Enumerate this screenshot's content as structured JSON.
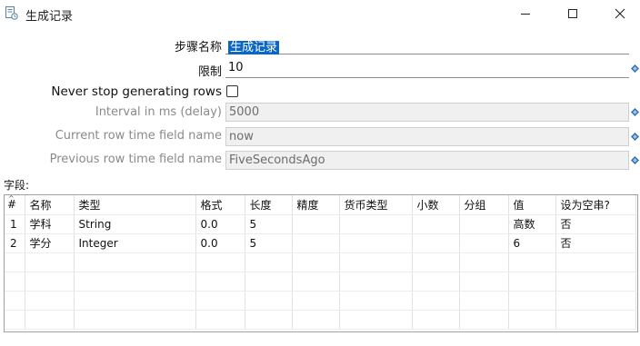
{
  "window": {
    "title": "生成记录",
    "minimize_glyph": "—",
    "maximize_glyph": "☐",
    "close_glyph": "✕"
  },
  "form": {
    "step_name_label": "步骤名称",
    "step_name_value": "生成记录",
    "limit_label": "限制",
    "limit_value": "10",
    "never_stop_label": "Never stop generating rows",
    "never_stop_checked": false,
    "interval_label": "Interval in ms (delay)",
    "interval_value": "5000",
    "current_time_label": "Current row time field name",
    "current_time_value": "now",
    "previous_time_label": "Previous row time field name",
    "previous_time_value": "FiveSecondsAgo"
  },
  "fields": {
    "label": "字段:",
    "columns": [
      "#",
      "名称",
      "类型",
      "格式",
      "长度",
      "精度",
      "货币类型",
      "小数",
      "分组",
      "值",
      "设为空串?"
    ],
    "rows": [
      [
        "1",
        "学科",
        "String",
        "0.0",
        "5",
        "",
        "",
        "",
        "",
        "高数",
        "否"
      ],
      [
        "2",
        "学分",
        "Integer",
        "0.0",
        "5",
        "",
        "",
        "",
        "",
        "6",
        "否"
      ]
    ],
    "empty_rows": 4
  },
  "colors": {
    "selection": "#0b67c4",
    "variable_icon": "#2f6fae"
  },
  "icons": {
    "app": "generate-rows-icon",
    "variable": "variable-diamond-icon"
  }
}
